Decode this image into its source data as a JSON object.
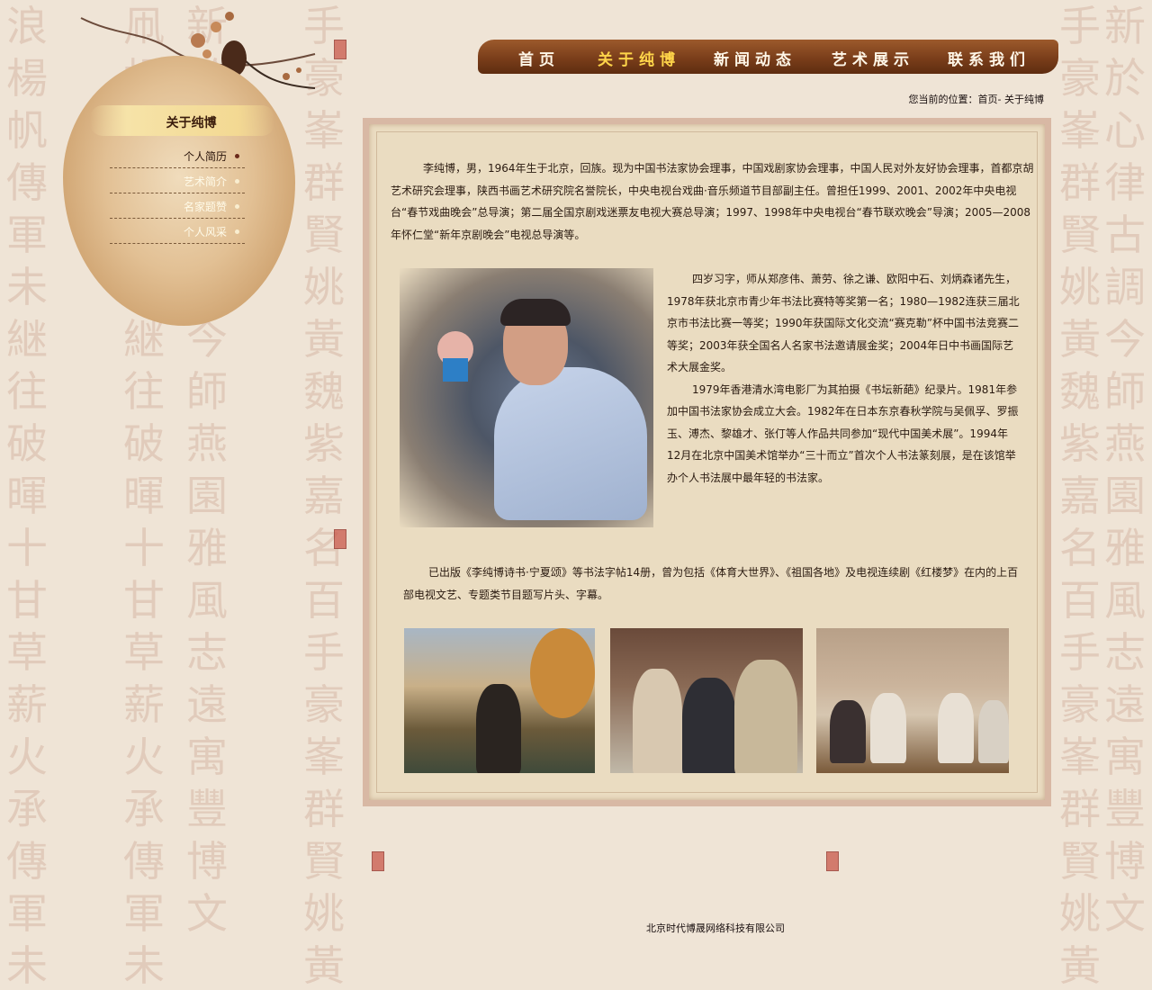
{
  "nav": {
    "items": [
      "首页",
      "关于纯博",
      "新闻动态",
      "艺术展示",
      "联系我们"
    ],
    "active_index": 1
  },
  "breadcrumb": "您当前的位置：首页- 关于纯博",
  "sidebar": {
    "title": "关于纯博",
    "items": [
      {
        "label": "个人简历",
        "active": true
      },
      {
        "label": "艺术简介",
        "active": false
      },
      {
        "label": "名家题赞",
        "active": false
      },
      {
        "label": "个人风采",
        "active": false
      }
    ]
  },
  "content": {
    "para1": "李纯博，男，1964年生于北京，回族。现为中国书法家协会理事，中国戏剧家协会理事，中国人民对外友好协会理事，首都京胡艺术研究会理事，陕西书画艺术研究院名誉院长，中央电视台戏曲·音乐频道节目部副主任。曾担任1999、2001、2002年中央电视台“春节戏曲晚会”总导演；第二届全国京剧戏迷票友电视大赛总导演；1997、1998年中央电视台“春节联欢晚会”导演；2005—2008年怀仁堂“新年京剧晚会”电视总导演等。",
    "para2a": "四岁习字，师从郑彦伟、萧劳、徐之谦、欧阳中石、刘炳森诸先生，1978年获北京市青少年书法比赛特等奖第一名；1980—1982连获三届北京市书法比赛一等奖；1990年获国际文化交流“赛克勒”杯中国书法竞赛二等奖；2003年获全国名人名家书法邀请展金奖；2004年日中书画国际艺术大展金奖。",
    "para2b": "1979年香港清水湾电影厂为其拍摄《书坛新葩》纪录片。1981年参加中国书法家协会成立大会。1982年在日本东京春秋学院与吴佩孚、罗振玉、溥杰、黎雄才、张仃等人作品共同参加“现代中国美术展”。1994年12月在北京中国美术馆举办“三十而立”首次个人书法篆刻展，是在该馆举办个人书法展中最年轻的书法家。",
    "para3": "已出版《李纯博诗书·宁夏颂》等书法字帖14册，曾为包括《体育大世界》、《祖国各地》及电视连续剧《红楼梦》在内的上百部电视文艺、专题类节目题写片头、字幕。"
  },
  "footer": "北京时代博晟网络科技有限公司",
  "background_calligraphy": {
    "col1": "浪楊帆傳軍未継往破暉十甘草薪火承傳軍未継往破",
    "col2": "凧楊帆傳軍未継往破暉十甘草薪火承傳軍未継往破",
    "col3": "新於心律古調今師燕園雅風志遠寓豐博文",
    "col4": "手豪峯群賢姚黃魏紫嘉名百手豪峯群賢姚黃"
  },
  "colors": {
    "background": "#efe4d6",
    "nav_bar": "#7a3e1a",
    "nav_active": "#ffd54a",
    "frame_border": "#d8b8a4",
    "frame_bg": "#eadcc1"
  },
  "icons": [
    "branch-decoration",
    "bird-icon",
    "seal-stamp-icon",
    "menu-dot-icon"
  ]
}
